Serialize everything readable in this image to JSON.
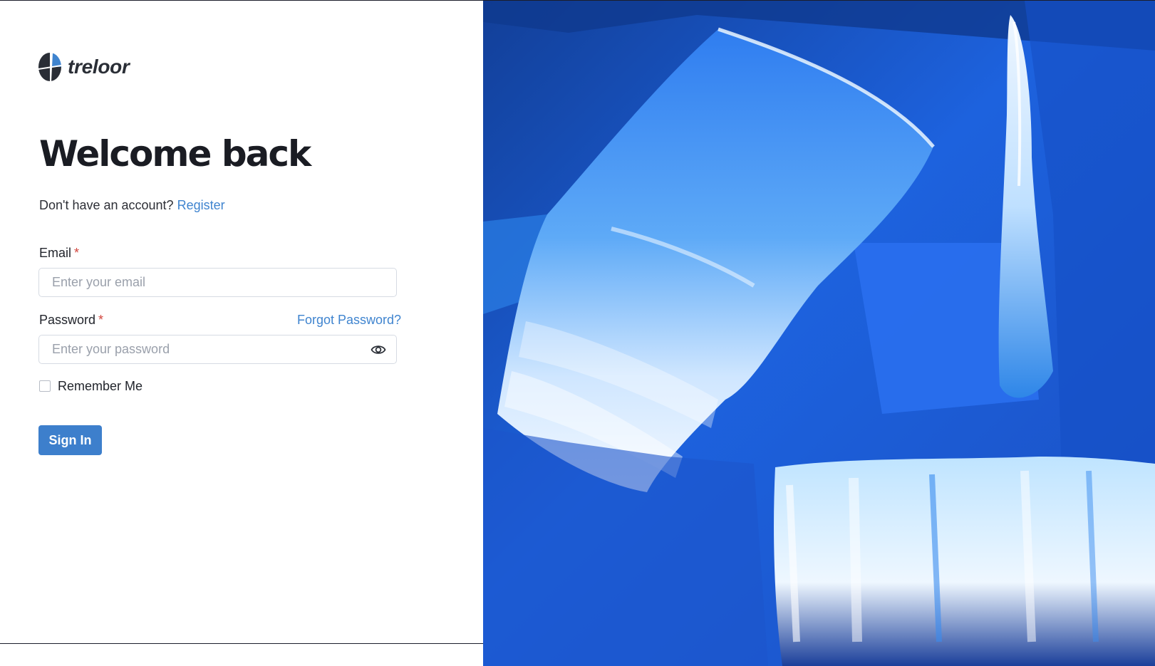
{
  "brand": {
    "name": "treloor",
    "logo_icon": "split-circle-logo-icon",
    "logo_colors": [
      "#2a2e36",
      "#3f84cf"
    ]
  },
  "login": {
    "title": "Welcome back",
    "register_prompt": "Don't have an account?",
    "register_link": "Register",
    "email": {
      "label": "Email",
      "required_mark": "*",
      "placeholder": "Enter your email",
      "value": ""
    },
    "password": {
      "label": "Password",
      "required_mark": "*",
      "placeholder": "Enter your password",
      "value": "",
      "toggle_icon": "eye-icon"
    },
    "forgot_password": "Forgot Password?",
    "remember_me": {
      "label": "Remember Me",
      "checked": false
    },
    "submit_label": "Sign In"
  },
  "hero_image": {
    "description": "abstract blue acrylic paint strokes",
    "colors": {
      "base": "#1f65e6",
      "dark": "#0d3fa0",
      "light": "#7ec1ff",
      "highlight": "#eaf3ff"
    }
  },
  "colors": {
    "accent": "#3f84cf",
    "button": "#3d7fcc",
    "required": "#d2453d",
    "text": "#1a1c23"
  }
}
